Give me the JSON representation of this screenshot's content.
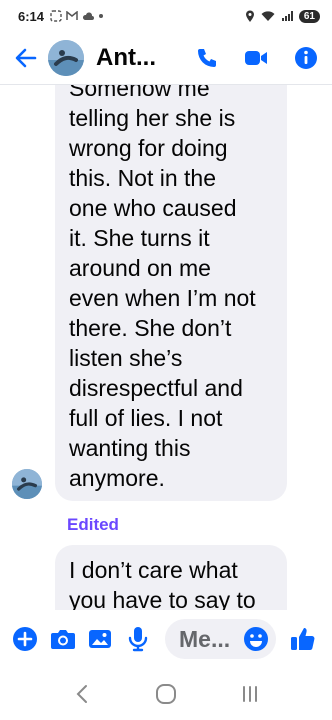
{
  "status_bar": {
    "time": "6:14",
    "battery": "61"
  },
  "header": {
    "contact_name": "Ant...",
    "back_icon": "arrow-left-icon",
    "call_icon": "phone-icon",
    "video_icon": "video-camera-icon",
    "info_icon": "info-icon"
  },
  "messages": [
    {
      "text": "Somehow me\ntelling her she is\nwrong for doing\nthis.  Not in the\none who caused\nit.  She turns it\naround on me\neven when I’m not\nthere.   She don’t\nlisten she’s\ndisrespectful and\nfull of lies.  I not\nwanting this\nanymore."
    },
    {
      "status": "Edited",
      "text": "I don’t care what\nyou have to say to"
    }
  ],
  "composer": {
    "placeholder": "Me...",
    "tools": [
      "plus-icon",
      "camera-icon",
      "gallery-icon",
      "microphone-icon"
    ],
    "emoji_icon": "emoji-icon",
    "like_icon": "thumbs-up-icon"
  },
  "nav": [
    "back-nav-icon",
    "home-nav-icon",
    "recents-nav-icon"
  ],
  "colors": {
    "accent": "#0866ff",
    "edited": "#6b48ff",
    "bubble": "#f0f0f5"
  }
}
